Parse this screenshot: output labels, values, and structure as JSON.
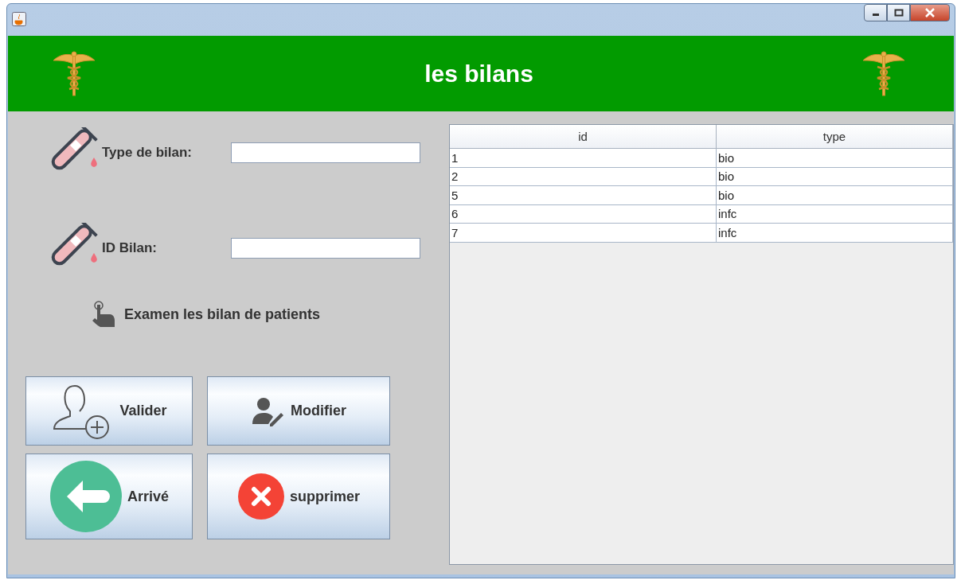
{
  "header": {
    "title": "les bilans"
  },
  "form": {
    "fields": [
      {
        "label": "Type de bilan:"
      },
      {
        "label": "ID Bilan:"
      }
    ],
    "hint": "Examen les bilan de patients"
  },
  "buttons": [
    {
      "label": "Valider",
      "kind": "add-user"
    },
    {
      "label": "Modifier",
      "kind": "edit-user"
    },
    {
      "label": "Arrivé",
      "kind": "back"
    },
    {
      "label": "supprimer",
      "kind": "delete"
    }
  ],
  "table": {
    "columns": [
      "id",
      "type"
    ],
    "rows": [
      [
        "1",
        "bio"
      ],
      [
        "2",
        "bio"
      ],
      [
        "5",
        "bio"
      ],
      [
        "6",
        "infc"
      ],
      [
        "7",
        "infc"
      ]
    ]
  }
}
